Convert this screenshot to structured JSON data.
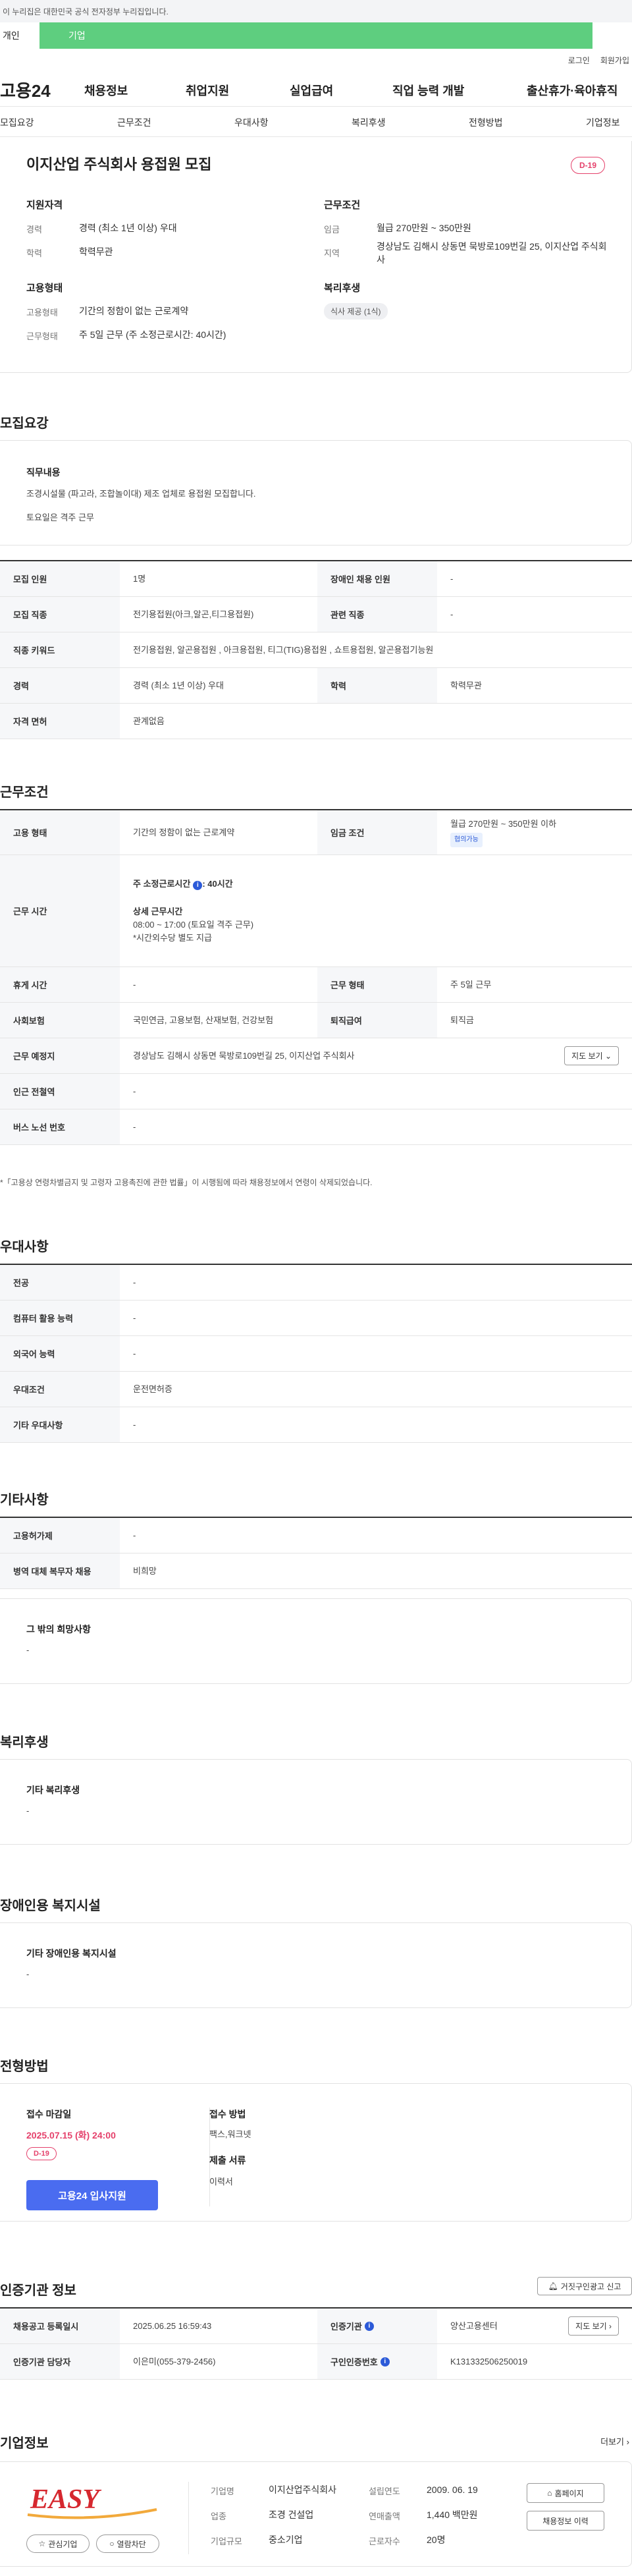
{
  "notice": "이 누리집은 대한민국 공식 전자정부 누리집입니다.",
  "tabs": {
    "personal": "개인",
    "company": "기업"
  },
  "util": {
    "login": "로그인",
    "signup": "회원가입"
  },
  "logo": "고용24",
  "gnb": [
    "채용정보",
    "취업지원",
    "실업급여",
    "직업 능력 개발",
    "출산휴가·육아휴직"
  ],
  "subnav": [
    "모집요강",
    "근무조건",
    "우대사항",
    "복리후생",
    "전형방법",
    "기업정보"
  ],
  "job": {
    "title": "이지산업 주식회사 용접원 모집",
    "dday": "D-19",
    "qual_heading": "지원자격",
    "career_label": "경력",
    "career_value": "경력 (최소 1년 이상) 우대",
    "edu_label": "학력",
    "edu_value": "학력무관",
    "cond_heading": "근무조건",
    "wage_label": "임금",
    "wage_value": "월급 270만원 ~ 350만원",
    "loc_label": "지역",
    "loc_value": "경상남도 김해시 상동면 묵방로109번길 25, 이지산업 주식회사",
    "emp_heading": "고용형태",
    "emp_type_label": "고용형태",
    "emp_type_value": "기간의 정함이 없는 근로계약",
    "work_type_label": "근무형태",
    "work_type_value": "주 5일 근무 (주 소정근로시간: 40시간)",
    "welfare_heading": "복리후생",
    "welfare_chip": "식사 제공 (1식)"
  },
  "recruit": {
    "heading": "모집요강",
    "duty_heading": "직무내용",
    "duty_line1": "조경시설물 (파고라, 조합놀이대) 제조 업체로  용접원 모집합니다.",
    "duty_line2": "토요일은 격주 근무",
    "rows": [
      {
        "k": "모집 인원",
        "v": "1명",
        "k2": "장애인 채용 인원",
        "v2": "-"
      },
      {
        "k": "모집 직종",
        "v": "전기용접원(아크,알곤,티그용접원)",
        "k2": "관련 직종",
        "v2": "-"
      },
      {
        "k": "직종 키워드",
        "v": "전기용접원, 알곤용접원 , 아크용접원, 티그(TIG)용접원 , 쇼트용접원, 알곤용접기능원"
      },
      {
        "k": "경력",
        "v": "경력 (최소 1년 이상) 우대",
        "k2": "학력",
        "v2": "학력무관"
      },
      {
        "k": "자격 면허",
        "v": "관계없음"
      }
    ]
  },
  "conditions": {
    "heading": "근무조건",
    "emp_k": "고용 형태",
    "emp_v": "기간의 정함이 없는 근로계약",
    "wage_k": "임금 조건",
    "wage_v": "월급 270만원 ~ 350만원 이하",
    "wage_chip": "협의가능",
    "time_k": "근무 시간",
    "time_line1": "주 소정근로시간",
    "time_hours": ": 40시간",
    "time_line2": "상세 근무시간",
    "time_line3": "08:00 ~ 17:00 (토요일 격주 근무)",
    "time_line4": "*시간외수당 별도 지급",
    "rest_k": "휴게 시간",
    "rest_v": "-",
    "worktype_k": "근무 형태",
    "worktype_v": "주 5일 근무",
    "ins_k": "사회보험",
    "ins_v": "국민연금, 고용보험, 산재보험, 건강보험",
    "sev_k": "퇴직급여",
    "sev_v": "퇴직금",
    "addr_k": "근무 예정지",
    "addr_v": "경상남도 김해시 상동면 묵방로109번길 25, 이지산업 주식회사",
    "map_btn": "지도 보기",
    "subway_k": "인근 전철역",
    "subway_v": "-",
    "bus_k": "버스 노선 번호",
    "bus_v": "-",
    "note": "*「고용상 연령차별금지 및 고령자 고용촉진에 관한 법률」이 시행됨에 따라 채용정보에서 연령이 삭제되었습니다."
  },
  "pref": {
    "heading": "우대사항",
    "rows": [
      {
        "k": "전공",
        "v": "-"
      },
      {
        "k": "컴퓨터 활용 능력",
        "v": "-"
      },
      {
        "k": "외국어 능력",
        "v": "-"
      },
      {
        "k": "우대조건",
        "v": "운전면허증"
      },
      {
        "k": "기타 우대사항",
        "v": "-"
      }
    ]
  },
  "etc": {
    "heading": "기타사항",
    "rows": [
      {
        "k": "고용허가제",
        "v": "-"
      },
      {
        "k": "병역 대체 복무자 채용",
        "v": "비희망"
      }
    ],
    "hope_heading": "그 밖의 희망사항",
    "hope_value": "-"
  },
  "welfare": {
    "heading": "복리후생",
    "box_heading": "기타 복리후생",
    "box_value": "-"
  },
  "disabled": {
    "heading": "장애인용 복지시설",
    "box_heading": "기타 장애인용 복지시설",
    "box_value": "-"
  },
  "process": {
    "heading": "전형방법",
    "deadline_label": "접수 마감일",
    "deadline_value": "2025.07.15 (화) 24:00",
    "dday": "D-19",
    "apply_btn": "고용24 입사지원",
    "method_label": "접수 방법",
    "method_value": "팩스,워크넷",
    "docs_label": "제출 서류",
    "docs_value": "이력서"
  },
  "agency": {
    "heading": "인증기관 정보",
    "report_btn": "거짓구인광고 신고",
    "reg_k": "채용공고 등록일시",
    "reg_v": "2025.06.25 16:59:43",
    "org_k": "인증기관",
    "org_v": "양산고용센터",
    "map_btn": "지도 보기",
    "mgr_k": "인증기관 담당자",
    "mgr_v": "이은미(055-379-2456)",
    "no_k": "구인인증번호",
    "no_v": "K131332506250019"
  },
  "company": {
    "heading": "기업정보",
    "more": "더보기",
    "logo_text": "EASY",
    "name_k": "기업명",
    "name_v": "이지산업주식회사",
    "year_k": "설립연도",
    "year_v": "2009. 06. 19",
    "biz_k": "업종",
    "biz_v": "조경 건설업",
    "sales_k": "연매출액",
    "sales_v": "1,440 백만원",
    "size_k": "기업규모",
    "size_v": "중소기업",
    "emp_k": "근로자수",
    "emp_v": "20명",
    "home_btn": "홈페이지",
    "jobs_btn": "채용정보 이력",
    "fav_btn": "관심기업",
    "block_btn": "열람차단"
  }
}
